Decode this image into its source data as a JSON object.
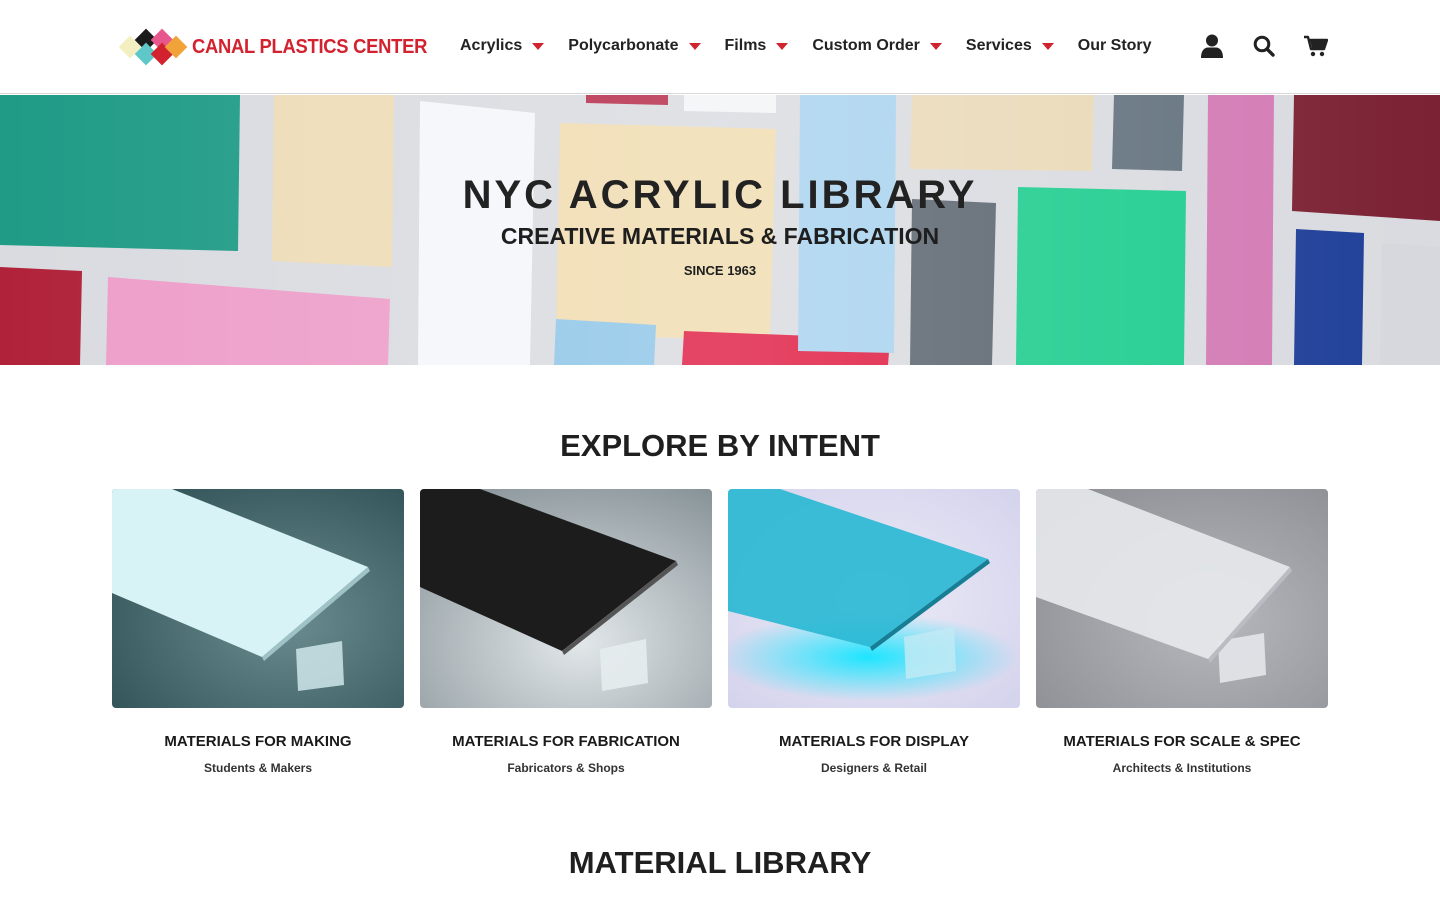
{
  "header": {
    "logo": {
      "text": "CANAL PLASTICS CENTER",
      "text_color": "#d3222f",
      "mark_colors": [
        "#f3efc0",
        "#1b1b1b",
        "#5ec8c9",
        "#e8568e",
        "#d3222f",
        "#f1a33a"
      ]
    },
    "nav": [
      {
        "label": "Acrylics",
        "has_dropdown": true
      },
      {
        "label": "Polycarbonate",
        "has_dropdown": true
      },
      {
        "label": "Films",
        "has_dropdown": true
      },
      {
        "label": "Custom Order",
        "has_dropdown": true
      },
      {
        "label": "Services",
        "has_dropdown": true
      },
      {
        "label": "Our Story",
        "has_dropdown": false
      }
    ],
    "icons": [
      "user-account-icon",
      "search-icon",
      "cart-icon"
    ],
    "accent_color": "#d3222f"
  },
  "hero": {
    "title": "NYC ACRYLIC LIBRARY",
    "subtitle": "CREATIVE MATERIALS & FABRICATION",
    "tagline": "SINCE 1963"
  },
  "explore": {
    "title": "EXPLORE BY INTENT",
    "cards": [
      {
        "title": "MATERIALS FOR MAKING",
        "subtitle": "Students & Makers",
        "sheet_color": "#d8f3f6",
        "background_color": "#3e6266"
      },
      {
        "title": "MATERIALS FOR FABRICATION",
        "subtitle": "Fabricators & Shops",
        "sheet_color": "#1c1c1c",
        "background_color": "#a9b3b6"
      },
      {
        "title": "MATERIALS FOR DISPLAY",
        "subtitle": "Designers & Retail",
        "sheet_color": "#2bb8d4",
        "background_color": "#dcdcf0"
      },
      {
        "title": "MATERIALS FOR SCALE & SPEC",
        "subtitle": "Architects & Institutions",
        "sheet_color": "#e6e8ec",
        "background_color": "#8e9096"
      }
    ]
  },
  "library": {
    "title": "MATERIAL LIBRARY"
  }
}
